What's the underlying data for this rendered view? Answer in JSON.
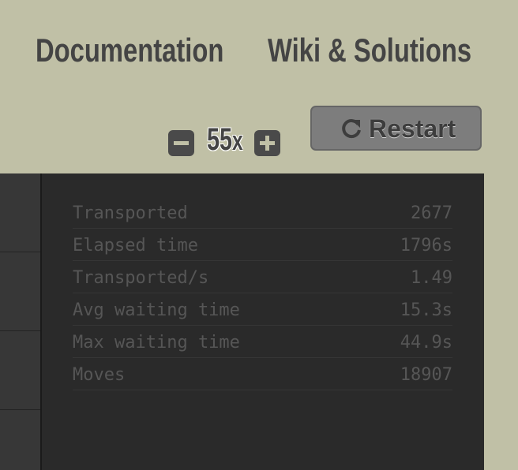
{
  "nav": {
    "documentation": "Documentation",
    "wiki": "Wiki & Solutions"
  },
  "speed": {
    "value": "55",
    "suffix": "x"
  },
  "restart": {
    "label": "Restart",
    "icon": "restart-arrow-icon"
  },
  "stats": [
    {
      "label": "Transported",
      "value": "2677"
    },
    {
      "label": "Elapsed time",
      "value": "1796s"
    },
    {
      "label": "Transported/s",
      "value": "1.49"
    },
    {
      "label": "Avg waiting time",
      "value": "15.3s"
    },
    {
      "label": "Max waiting time",
      "value": "44.9s"
    },
    {
      "label": "Moves",
      "value": "18907"
    }
  ],
  "colors": {
    "background": "#c0c0a6",
    "panel": "#2a2a2a",
    "text_dark": "#444444",
    "stat_text": "#565656",
    "button": "#7d7d7d"
  }
}
